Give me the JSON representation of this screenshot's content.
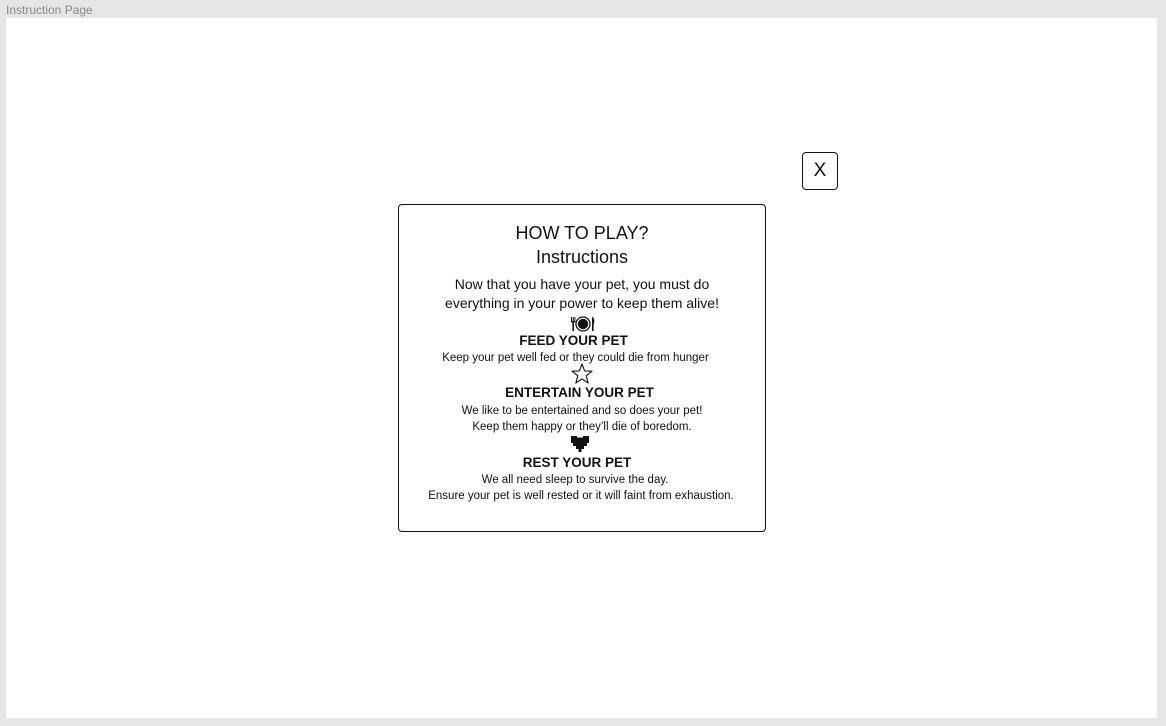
{
  "frame": {
    "label": "Instruction Page"
  },
  "close_button": {
    "label": "X"
  },
  "card": {
    "title": "HOW TO PLAY?",
    "subtitle": "Instructions",
    "intro": [
      "Now that you have your pet, you must do",
      "everything in your power to keep them alive!"
    ],
    "sections": [
      {
        "icon": "plate-cutlery-icon",
        "title": "FEED YOUR PET",
        "lines": [
          "Keep your pet well fed or they could die from hunger"
        ]
      },
      {
        "icon": "star-icon",
        "title": "ENTERTAIN YOUR PET",
        "lines": [
          "We like to be entertained and so does your pet!",
          "Keep them happy or they’ll die of boredom."
        ]
      },
      {
        "icon": "heart-icon",
        "title": "REST YOUR PET",
        "lines": [
          "We all need sleep to  survive the day.",
          "Ensure your pet is well rested or it will faint from exhaustion."
        ]
      }
    ]
  }
}
